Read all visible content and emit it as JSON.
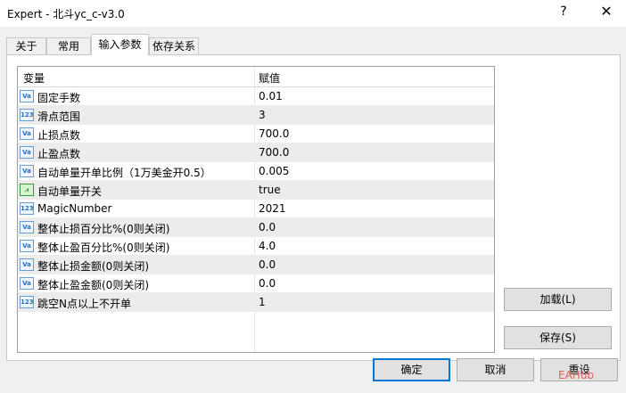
{
  "window": {
    "title": "Expert - 北斗yc_c-v3.0",
    "help": "?",
    "close": "✕"
  },
  "tabs": [
    {
      "label": "关于"
    },
    {
      "label": "常用"
    },
    {
      "label": "输入参数"
    },
    {
      "label": "依存关系"
    }
  ],
  "table": {
    "col_variable": "变量",
    "col_value": "赋值",
    "rows": [
      {
        "icon": "Va",
        "name": "固定手数",
        "value": "0.01"
      },
      {
        "icon": "123",
        "name": "滑点范围",
        "value": "3"
      },
      {
        "icon": "Va",
        "name": "止损点数",
        "value": "700.0"
      },
      {
        "icon": "Va",
        "name": "止盈点数",
        "value": "700.0"
      },
      {
        "icon": "Va",
        "name": "自动单量开单比例（1万美金开0.5）",
        "value": "0.005"
      },
      {
        "icon": "bool",
        "name": "自动单量开关",
        "value": "true"
      },
      {
        "icon": "123",
        "name": "MagicNumber",
        "value": "2021"
      },
      {
        "icon": "Va",
        "name": "整体止损百分比%(0则关闭)",
        "value": "0.0"
      },
      {
        "icon": "Va",
        "name": "整体止盈百分比%(0则关闭)",
        "value": "4.0"
      },
      {
        "icon": "Va",
        "name": "整体止损金额(0则关闭)",
        "value": "0.0"
      },
      {
        "icon": "Va",
        "name": "整体止盈金额(0则关闭)",
        "value": "0.0"
      },
      {
        "icon": "123",
        "name": "跳空N点以上不开单",
        "value": "1"
      }
    ]
  },
  "buttons": {
    "load": "加载(L)",
    "save": "保存(S)",
    "ok": "确定",
    "cancel": "取消",
    "reset": "重设"
  },
  "watermark": "EAHub"
}
